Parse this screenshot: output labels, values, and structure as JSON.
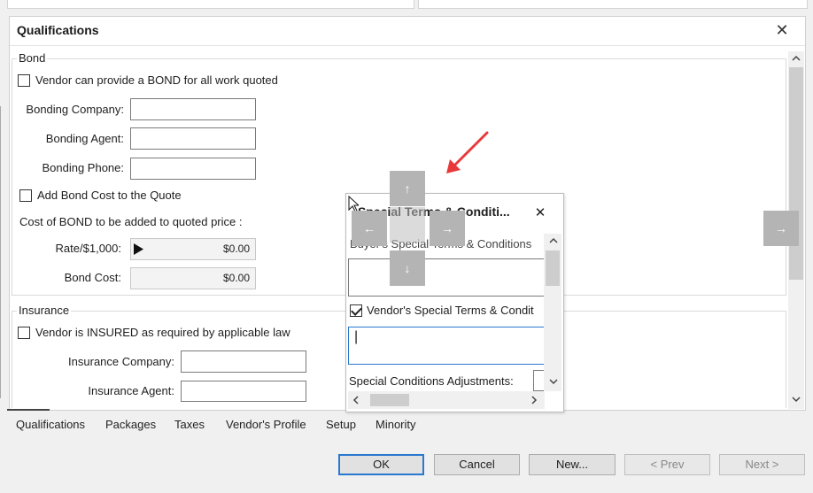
{
  "panel": {
    "title": "Qualifications",
    "close_glyph": "✕"
  },
  "bond": {
    "group_title": "Bond",
    "provide_bond_label": "Vendor can provide a BOND for all work quoted",
    "provide_bond_checked": false,
    "bonding_company_label": "Bonding Company:",
    "bonding_company_value": "",
    "bonding_agent_label": "Bonding Agent:",
    "bonding_agent_value": "",
    "bonding_phone_label": "Bonding Phone:",
    "bonding_phone_value": "",
    "add_bond_cost_label": "Add Bond Cost to the Quote",
    "add_bond_cost_checked": false,
    "cost_heading": "Cost of BOND to be added to quoted price :",
    "rate_label": "Rate/$1,000:",
    "rate_value": "$0.00",
    "bond_cost_label": "Bond Cost:",
    "bond_cost_value": "$0.00"
  },
  "insurance": {
    "group_title": "Insurance",
    "insured_label": "Vendor is INSURED as required by applicable law",
    "insured_checked": false,
    "company_label": "Insurance Company:",
    "company_value": "",
    "agent_label": "Insurance Agent:",
    "agent_value": ""
  },
  "tabs": [
    "Qualifications",
    "Packages",
    "Taxes",
    "Vendor's Profile",
    "Setup",
    "Minority"
  ],
  "active_tab": "Qualifications",
  "buttons": {
    "ok": "OK",
    "cancel": "Cancel",
    "new": "New...",
    "prev": "< Prev",
    "next": "Next >"
  },
  "floating_dialog": {
    "title": "Special Terms & Conditi...",
    "close_glyph": "✕",
    "buyer_label": "Buyer's Special Terms & Conditions",
    "buyer_value": "",
    "vendor_label": "Vendor's Special Terms & Condit",
    "vendor_checked": true,
    "vendor_value": "|",
    "adjustments_label": "Special Conditions Adjustments:"
  },
  "dock_guides": {
    "up": "↑",
    "down": "↓",
    "left": "←",
    "right": "→",
    "far_right": "→"
  },
  "colors": {
    "accent_blue": "#2a77cf",
    "annotation_red": "#e8393a",
    "guide_gray": "#b4b4b4"
  }
}
